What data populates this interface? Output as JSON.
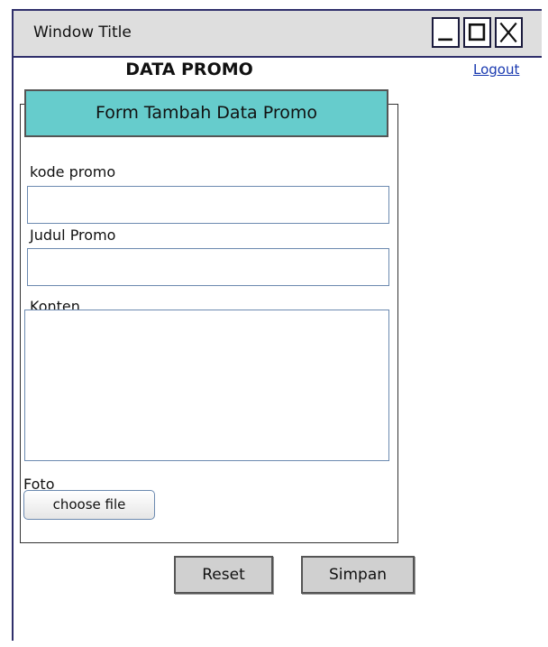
{
  "window": {
    "title": "Window Title",
    "controls": [
      "minimize-icon",
      "maximize-icon",
      "close-icon"
    ]
  },
  "page": {
    "title": "DATA PROMO",
    "logout_label": "Logout"
  },
  "form": {
    "header": "Form Tambah Data Promo",
    "fields": {
      "kode_label": "kode promo",
      "kode_value": "",
      "judul_label": "Judul Promo",
      "judul_value": "",
      "konten_label": "Konten",
      "konten_value": "",
      "foto_label": "Foto",
      "choose_file_label": "choose file"
    }
  },
  "actions": {
    "reset_label": "Reset",
    "simpan_label": "Simpan"
  },
  "colors": {
    "form_header_bg": "#66cccc",
    "window_border": "#2f2f6b",
    "link": "#1a3ab0",
    "button_bg": "#d0d0d0"
  }
}
